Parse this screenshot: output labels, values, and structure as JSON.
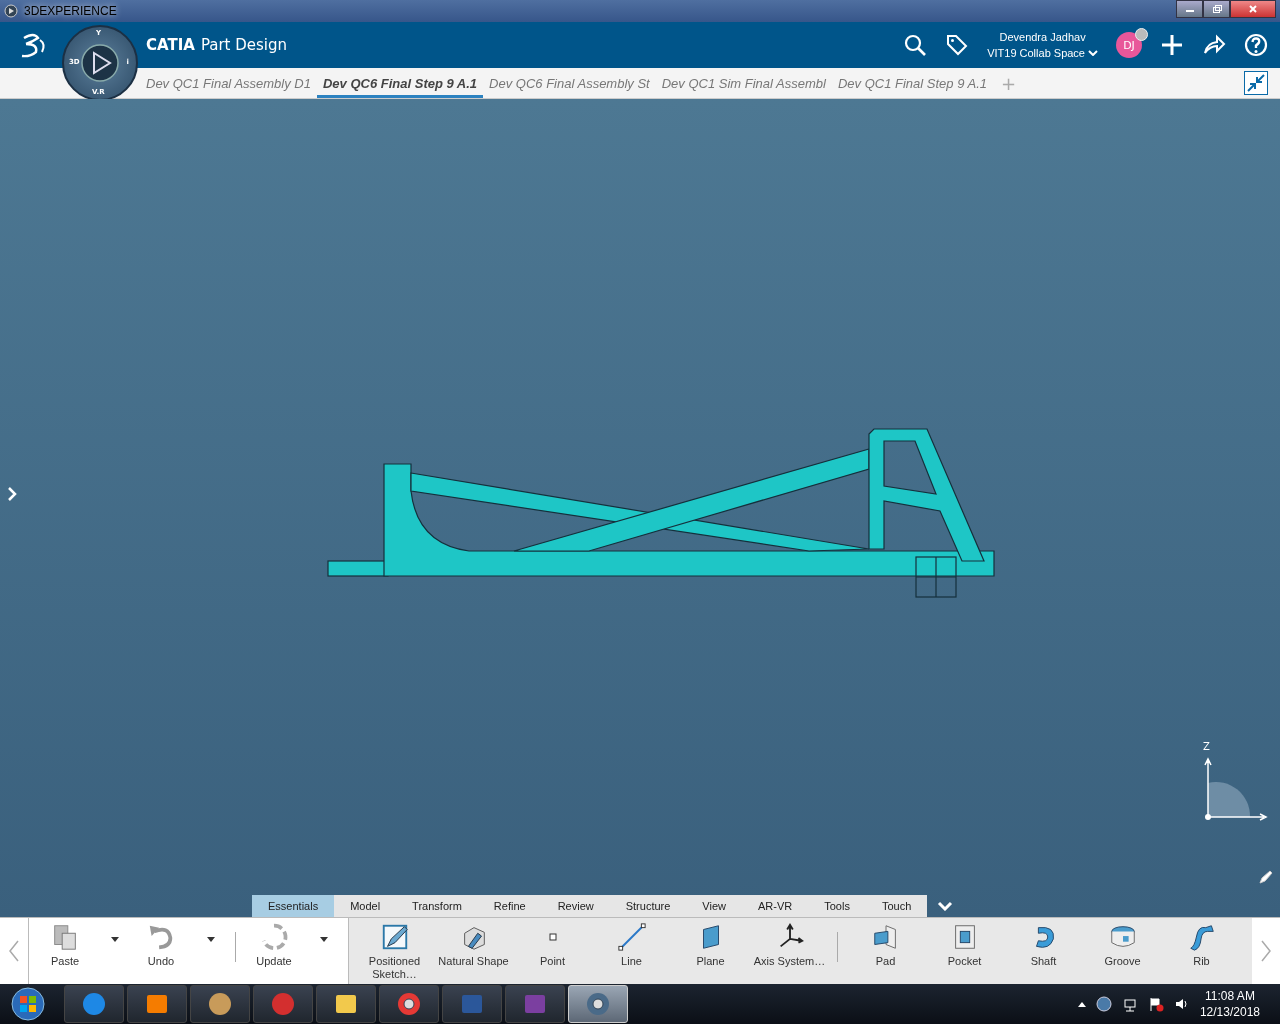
{
  "window": {
    "title": "3DEXPERIENCE"
  },
  "app": {
    "brand": "CATIA",
    "name": "Part Design"
  },
  "compass": {
    "top": "Y",
    "left": "3D",
    "right": "i",
    "bottom": "V.R"
  },
  "user": {
    "name": "Devendra Jadhav",
    "space": "VIT19 Collab Space",
    "initials": "DJ"
  },
  "tabs": [
    {
      "label": "Dev QC1 Final Assembly D1",
      "selected": false
    },
    {
      "label": "Dev QC6 Final Step 9 A.1",
      "selected": true
    },
    {
      "label": "Dev QC6 Final Assembly St",
      "selected": false
    },
    {
      "label": "Dev QC1 Sim Final Assembl",
      "selected": false
    },
    {
      "label": "Dev QC1 Final Step 9 A.1",
      "selected": false
    }
  ],
  "add_tab": "+",
  "axis": {
    "label": "Z"
  },
  "action_tabs": [
    {
      "label": "Essentials",
      "selected": true
    },
    {
      "label": "Model",
      "selected": false
    },
    {
      "label": "Transform",
      "selected": false
    },
    {
      "label": "Refine",
      "selected": false
    },
    {
      "label": "Review",
      "selected": false
    },
    {
      "label": "Structure",
      "selected": false
    },
    {
      "label": "View",
      "selected": false
    },
    {
      "label": "AR-VR",
      "selected": false
    },
    {
      "label": "Tools",
      "selected": false
    },
    {
      "label": "Touch",
      "selected": false
    }
  ],
  "sections": [
    {
      "groups": [
        [
          {
            "label": "Paste",
            "kind": "paste",
            "dropdown": true
          },
          {
            "label": "Undo",
            "kind": "undo",
            "dropdown": true
          }
        ],
        [
          {
            "label": "Update",
            "kind": "update",
            "dropdown": true
          }
        ]
      ]
    },
    {
      "groups": [
        [
          {
            "label": "Positioned Sketch…",
            "kind": "sketch",
            "dropdown": false
          },
          {
            "label": "Natural Shape",
            "kind": "shape",
            "dropdown": false
          },
          {
            "label": "Point",
            "kind": "point",
            "dropdown": false
          },
          {
            "label": "Line",
            "kind": "line",
            "dropdown": false
          },
          {
            "label": "Plane",
            "kind": "plane",
            "dropdown": false
          },
          {
            "label": "Axis System…",
            "kind": "axis",
            "dropdown": false
          }
        ],
        [
          {
            "label": "Pad",
            "kind": "pad",
            "dropdown": false
          },
          {
            "label": "Pocket",
            "kind": "pocket",
            "dropdown": false
          },
          {
            "label": "Shaft",
            "kind": "shaft",
            "dropdown": false
          },
          {
            "label": "Groove",
            "kind": "groove",
            "dropdown": false
          },
          {
            "label": "Rib",
            "kind": "rib",
            "dropdown": false
          }
        ]
      ]
    }
  ],
  "taskbar": {
    "apps": [
      {
        "kind": "browser",
        "active": false
      },
      {
        "kind": "player",
        "active": false
      },
      {
        "kind": "paint",
        "active": false
      },
      {
        "kind": "snipping",
        "active": false
      },
      {
        "kind": "folder",
        "active": false
      },
      {
        "kind": "chrome",
        "active": false
      },
      {
        "kind": "word",
        "active": false
      },
      {
        "kind": "onenote",
        "active": false
      },
      {
        "kind": "compass",
        "active": true
      }
    ],
    "time": "11:08 AM",
    "date": "12/13/2018"
  }
}
